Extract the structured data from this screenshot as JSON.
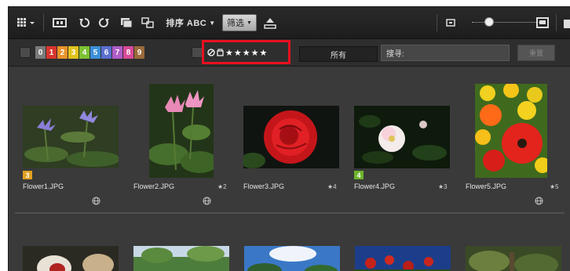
{
  "toolbar": {
    "sort_label": "排序 ABC",
    "filter_select": "筛选"
  },
  "label_filter": [
    "0",
    "1",
    "2",
    "3",
    "4",
    "5",
    "6",
    "7",
    "8",
    "9"
  ],
  "label_colors": [
    "#7a7a7a",
    "#d8342e",
    "#e8922a",
    "#e0c21c",
    "#7cc233",
    "#3b8fd8",
    "#5a6fd0",
    "#b05cc8",
    "#d84a98",
    "#9a6a3a"
  ],
  "rating_filter": {
    "stars": "★★★★★"
  },
  "all_button": "所有",
  "search": {
    "placeholder": "搜寻:",
    "go_label": "重置"
  },
  "thumbnails": [
    {
      "filename": "Flower1.JPG",
      "rating": "",
      "label": "3",
      "label_color": "#e0a020"
    },
    {
      "filename": "Flower2.JPG",
      "rating": "★2",
      "label": "",
      "label_color": ""
    },
    {
      "filename": "Flower3.JPG",
      "rating": "★4",
      "label": "",
      "label_color": ""
    },
    {
      "filename": "Flower4.JPG",
      "rating": "★3",
      "label": "4",
      "label_color": "#6cb32a"
    },
    {
      "filename": "Flower5.JPG",
      "rating": "★5",
      "label": "",
      "label_color": ""
    }
  ]
}
